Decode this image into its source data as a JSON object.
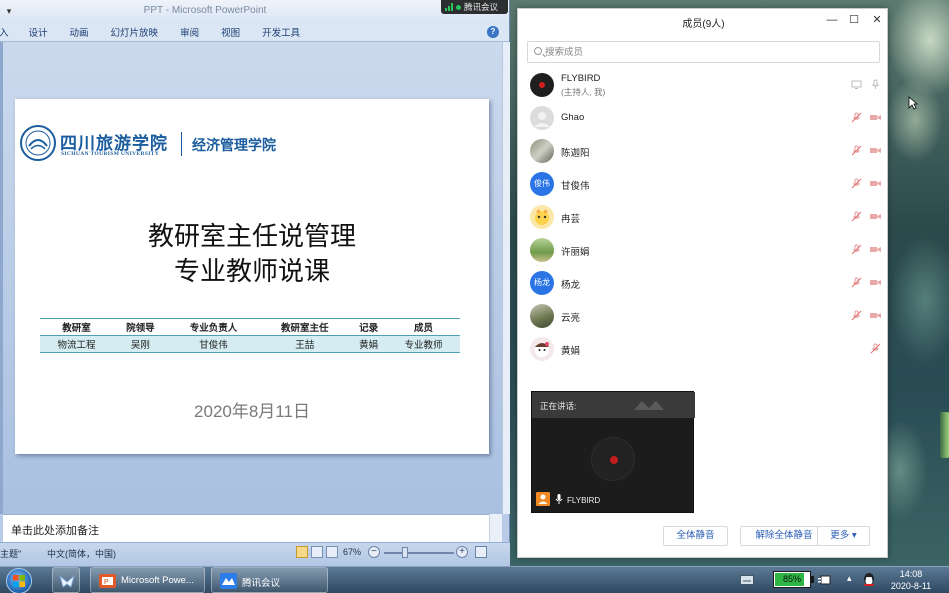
{
  "powerpoint": {
    "window_title": "PPT - Microsoft PowerPoint",
    "qat_symbol": "▾",
    "tabs": [
      "入",
      "设计",
      "动画",
      "幻灯片放映",
      "审阅",
      "视图",
      "开发工具"
    ],
    "help": "?",
    "slide": {
      "school_cn": "四川旅游学院",
      "school_en": "SICHUAN TOURISM UNIVERSITY",
      "college": "经济管理学院",
      "title_line1": "教研室主任说管理",
      "title_line2": "专业教师说课",
      "table": {
        "headers": [
          "教研室",
          "院领导",
          "专业负责人",
          "教研室主任",
          "记录",
          "成员"
        ],
        "row": [
          "物流工程",
          "吴刚",
          "甘俊伟",
          "王喆",
          "黄娟",
          "专业教师"
        ]
      },
      "date": "2020年8月11日"
    },
    "notes_placeholder": "单击此处添加备注",
    "status": {
      "theme": "主题\"",
      "language": "中文(简体，中国)",
      "zoom": "67%",
      "zoom_minus": "−",
      "zoom_plus": "+"
    }
  },
  "tencent_meeting_bar": {
    "label": "腾讯会议"
  },
  "members_panel": {
    "title": "成员(9人)",
    "controls": {
      "minimize": "—",
      "maximize": "☐",
      "close": "✕"
    },
    "search_placeholder": "搜索成员",
    "members": [
      {
        "name": "FLYBIRD",
        "sub": "(主持人, 我)",
        "avatar": "red-dot-icon"
      },
      {
        "name": "Ghao",
        "avatar": "default-user-icon"
      },
      {
        "name": "陈迦阳",
        "avatar": "photo"
      },
      {
        "name": "甘俊伟",
        "avatar_text": "俊伟",
        "avatar_color": "#2a74e6"
      },
      {
        "name": "冉芸",
        "avatar": "cartoon"
      },
      {
        "name": "许丽娟",
        "avatar": "photo"
      },
      {
        "name": "杨龙",
        "avatar_text": "杨龙",
        "avatar_color": "#2a74e6"
      },
      {
        "name": "云亮",
        "avatar": "photo"
      },
      {
        "name": "黄娟",
        "avatar": "cartoon"
      }
    ],
    "speaking": {
      "label": "正在讲话:",
      "name": "FLYBIRD"
    },
    "buttons": {
      "mute_all": "全体静音",
      "unmute_all": "解除全体静音",
      "more": "更多 ▾"
    }
  },
  "taskbar": {
    "items": [
      {
        "label": "Microsoft Powe..."
      },
      {
        "label": "腾讯会议"
      }
    ],
    "battery": "85%",
    "battery_level": 0.85,
    "time": "14:08",
    "date": "2020-8-11"
  }
}
